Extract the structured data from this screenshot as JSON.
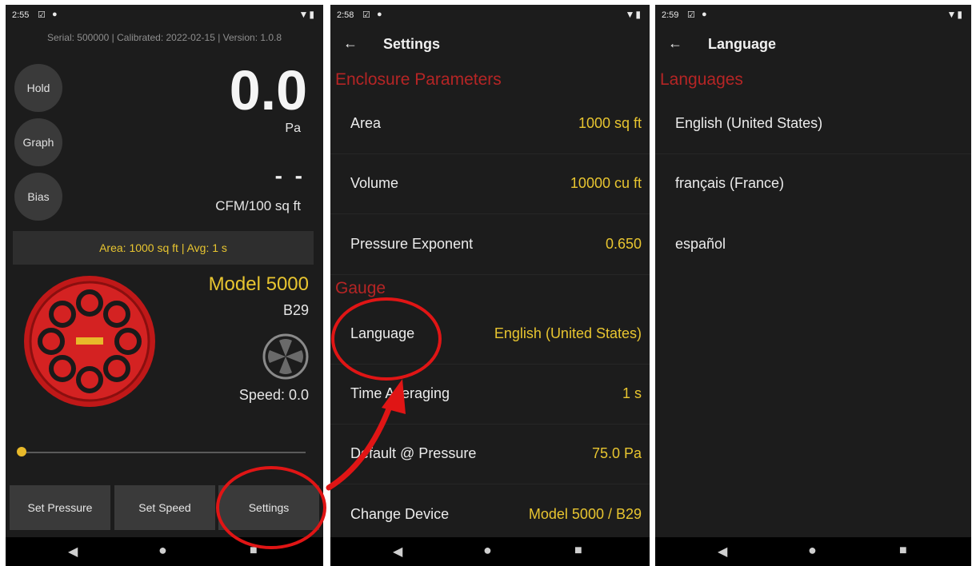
{
  "panels": {
    "main": {
      "status": {
        "time": "2:55"
      },
      "serial_line": "Serial: 500000 | Calibrated: 2022-02-15 | Version: 1.0.8",
      "buttons": {
        "hold": "Hold",
        "graph": "Graph",
        "bias": "Bias"
      },
      "pressure": {
        "value": "0.0",
        "unit": "Pa"
      },
      "flow": {
        "value": "- -",
        "unit": "CFM/100 sq ft"
      },
      "area_avg": "Area: 1000 sq ft | Avg: 1 s",
      "device": {
        "model": "Model 5000",
        "config": "B29",
        "speed": "Speed: 0.0"
      },
      "bottom": {
        "set_pressure": "Set Pressure",
        "set_speed": "Set Speed",
        "settings": "Settings"
      }
    },
    "settings": {
      "status": {
        "time": "2:58"
      },
      "title": "Settings",
      "sections": {
        "enclosure": "Enclosure Parameters",
        "gauge": "Gauge"
      },
      "rows": [
        {
          "label": "Area",
          "value": "1000 sq ft"
        },
        {
          "label": "Volume",
          "value": "10000 cu ft"
        },
        {
          "label": "Pressure Exponent",
          "value": "0.650"
        },
        {
          "label": "Language",
          "value": "English (United States)"
        },
        {
          "label": "Time Averaging",
          "value": "1 s"
        },
        {
          "label": "Default @ Pressure",
          "value": "75.0 Pa"
        },
        {
          "label": "Change Device",
          "value": "Model 5000 / B29"
        }
      ]
    },
    "language": {
      "status": {
        "time": "2:59"
      },
      "title": "Language",
      "section": "Languages",
      "options": [
        "English (United States)",
        "français (France)",
        "español"
      ]
    }
  },
  "colors": {
    "accent": "#e8c530",
    "section": "#b52525",
    "annotation": "#e01515",
    "background": "#1c1c1c"
  }
}
